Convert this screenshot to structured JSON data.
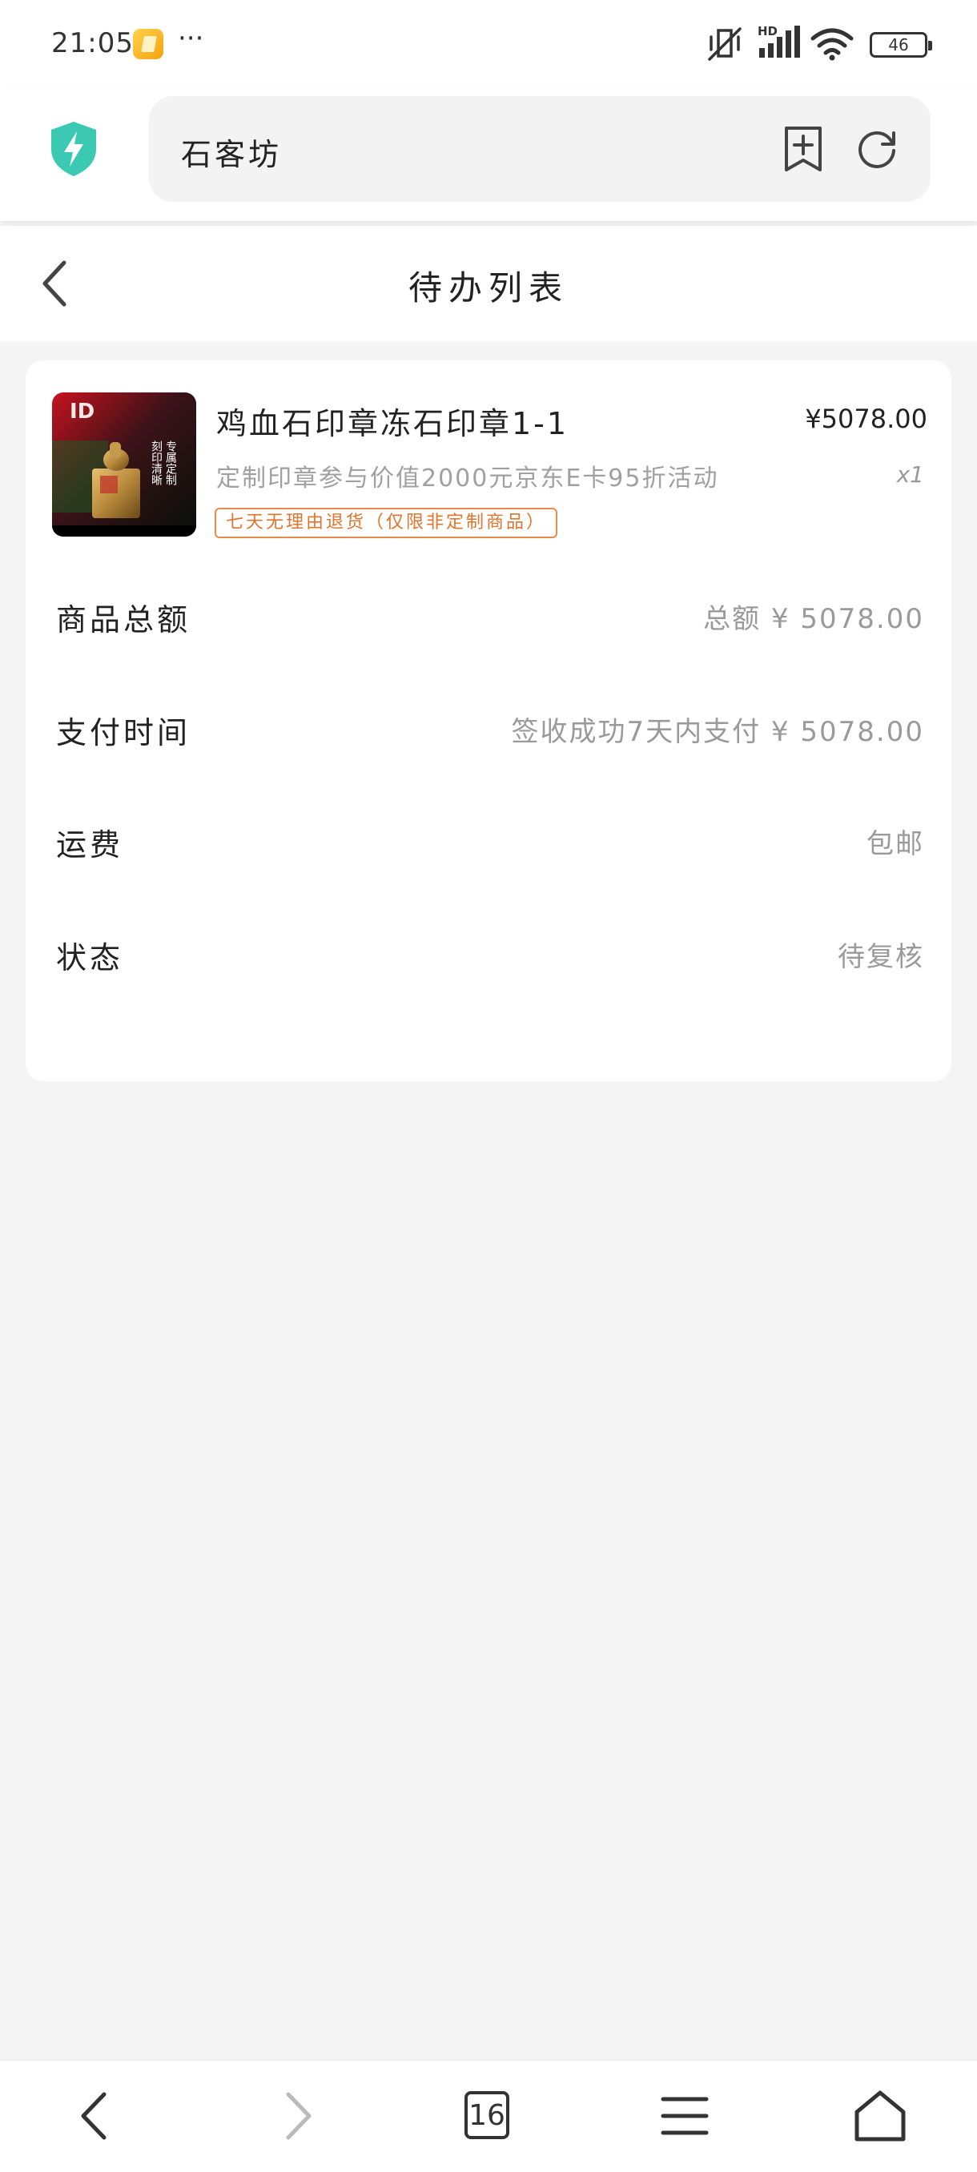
{
  "status_bar": {
    "time": "21:05",
    "more": "···",
    "battery": "46",
    "network_label": "HD"
  },
  "browser": {
    "url_title": "石客坊"
  },
  "page": {
    "title": "待办列表"
  },
  "product": {
    "name": "鸡血石印章冻石印章1-1",
    "price": "¥5078.00",
    "description": "定制印章参与价值2000元京东E卡95折活动",
    "quantity": "x1",
    "return_tag": "七天无理由退货（仅限非定制商品）",
    "image_id_badge": "ID",
    "image_caption": "专属定制 刻印清晰"
  },
  "info_rows": [
    {
      "label": "商品总额",
      "value": "总额 ¥ 5078.00"
    },
    {
      "label": "支付时间",
      "value": "签收成功7天内支付 ¥  5078.00"
    },
    {
      "label": "运费",
      "value": "包邮"
    },
    {
      "label": "状态",
      "value": "待复核"
    }
  ],
  "bottom_nav": {
    "tab_count": "16"
  },
  "colors": {
    "accent_shield": "#3cc9b3",
    "tag_orange": "#e2742b",
    "background": "#f4f4f4"
  }
}
